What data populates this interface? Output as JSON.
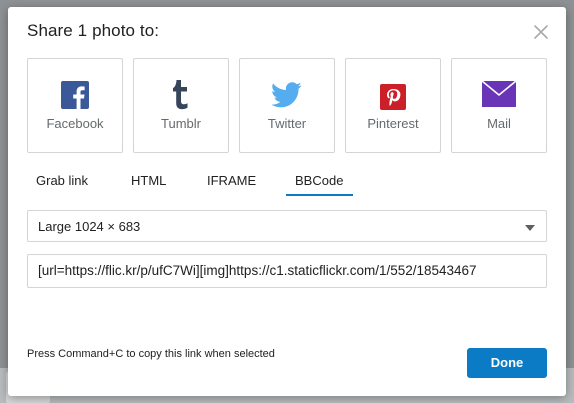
{
  "dialog": {
    "title": "Share 1 photo to:",
    "close_icon": "close-icon"
  },
  "services": [
    {
      "label": "Facebook",
      "icon": "facebook-icon",
      "color": "#3b5998"
    },
    {
      "label": "Tumblr",
      "icon": "tumblr-icon",
      "color": "#35465c"
    },
    {
      "label": "Twitter",
      "icon": "twitter-icon",
      "color": "#55acee"
    },
    {
      "label": "Pinterest",
      "icon": "pinterest-icon",
      "color": "#cb2027"
    },
    {
      "label": "Mail",
      "icon": "mail-icon",
      "color": "#6a34b6"
    }
  ],
  "tabs": [
    {
      "label": "Grab link",
      "active": false
    },
    {
      "label": "HTML",
      "active": false
    },
    {
      "label": "IFRAME",
      "active": false
    },
    {
      "label": "BBCode",
      "active": true
    }
  ],
  "size_select": {
    "value": "Large 1024 × 683"
  },
  "link_field": {
    "value": "[url=https://flic.kr/p/ufC7Wi][img]https://c1.staticflickr.com/1/552/18543467"
  },
  "footer": {
    "hint": "Press Command+C to copy this link when selected",
    "done_label": "Done"
  },
  "colors": {
    "accent": "#0a7bc4"
  }
}
